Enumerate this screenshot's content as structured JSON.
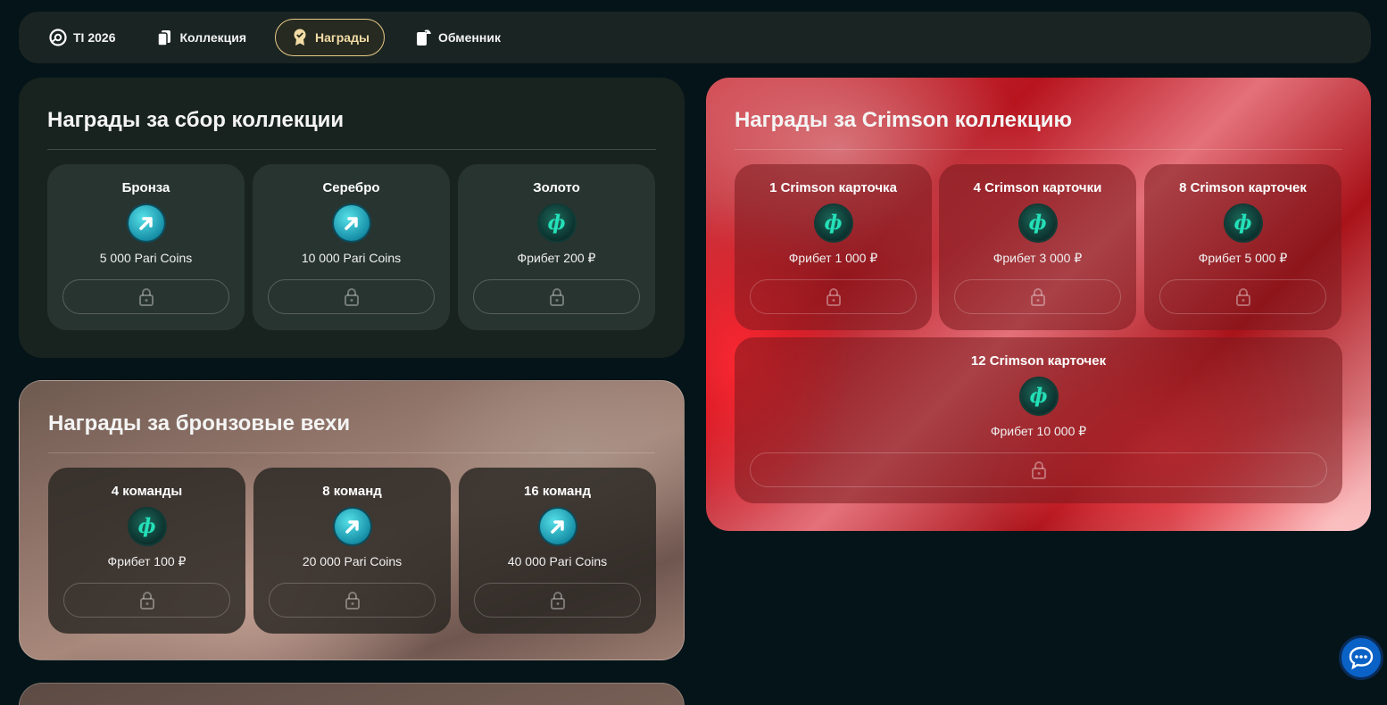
{
  "nav": {
    "items": [
      {
        "label": "TI 2026",
        "icon": "ti-logo-icon",
        "active": false
      },
      {
        "label": "Коллекция",
        "icon": "cards-icon",
        "active": false
      },
      {
        "label": "Награды",
        "icon": "medal-icon",
        "active": true
      },
      {
        "label": "Обменник",
        "icon": "exchange-icon",
        "active": false
      }
    ]
  },
  "collection_rewards": {
    "title": "Награды за сбор коллекции",
    "cards": [
      {
        "title": "Бронза",
        "icon": "pari-coin-icon",
        "value": "5 000 Pari Coins"
      },
      {
        "title": "Серебро",
        "icon": "pari-coin-icon",
        "value": "10 000 Pari Coins"
      },
      {
        "title": "Золото",
        "icon": "freebet-icon",
        "value": "Фрибет 200 ₽"
      }
    ]
  },
  "bronze_milestones": {
    "title": "Награды за бронзовые вехи",
    "cards": [
      {
        "title": "4 команды",
        "icon": "freebet-icon",
        "value": "Фрибет 100 ₽"
      },
      {
        "title": "8 команд",
        "icon": "pari-coin-icon",
        "value": "20 000 Pari Coins"
      },
      {
        "title": "16 команд",
        "icon": "pari-coin-icon",
        "value": "40 000 Pari Coins"
      }
    ]
  },
  "crimson_rewards": {
    "title": "Награды за Crimson коллекцию",
    "cards": [
      {
        "title": "1 Crimson карточка",
        "icon": "freebet-icon",
        "value": "Фрибет 1 000 ₽"
      },
      {
        "title": "4 Crimson карточки",
        "icon": "freebet-icon",
        "value": "Фрибет 3 000 ₽"
      },
      {
        "title": "8 Crimson карточек",
        "icon": "freebet-icon",
        "value": "Фрибет 5 000 ₽"
      },
      {
        "title": "12 Crimson карточек",
        "icon": "freebet-icon",
        "value": "Фрибет 10 000 ₽"
      }
    ]
  },
  "freebet_symbol": "ф",
  "colors": {
    "background": "#041418",
    "active_nav_border": "#e7c98a",
    "crimson_accent": "#b7141e",
    "freebet_green": "#24e0b8",
    "pari_cyan": "#56e0e8",
    "chat_blue": "#0a62c6"
  },
  "chat": {
    "icon": "chat-bubble-icon"
  }
}
